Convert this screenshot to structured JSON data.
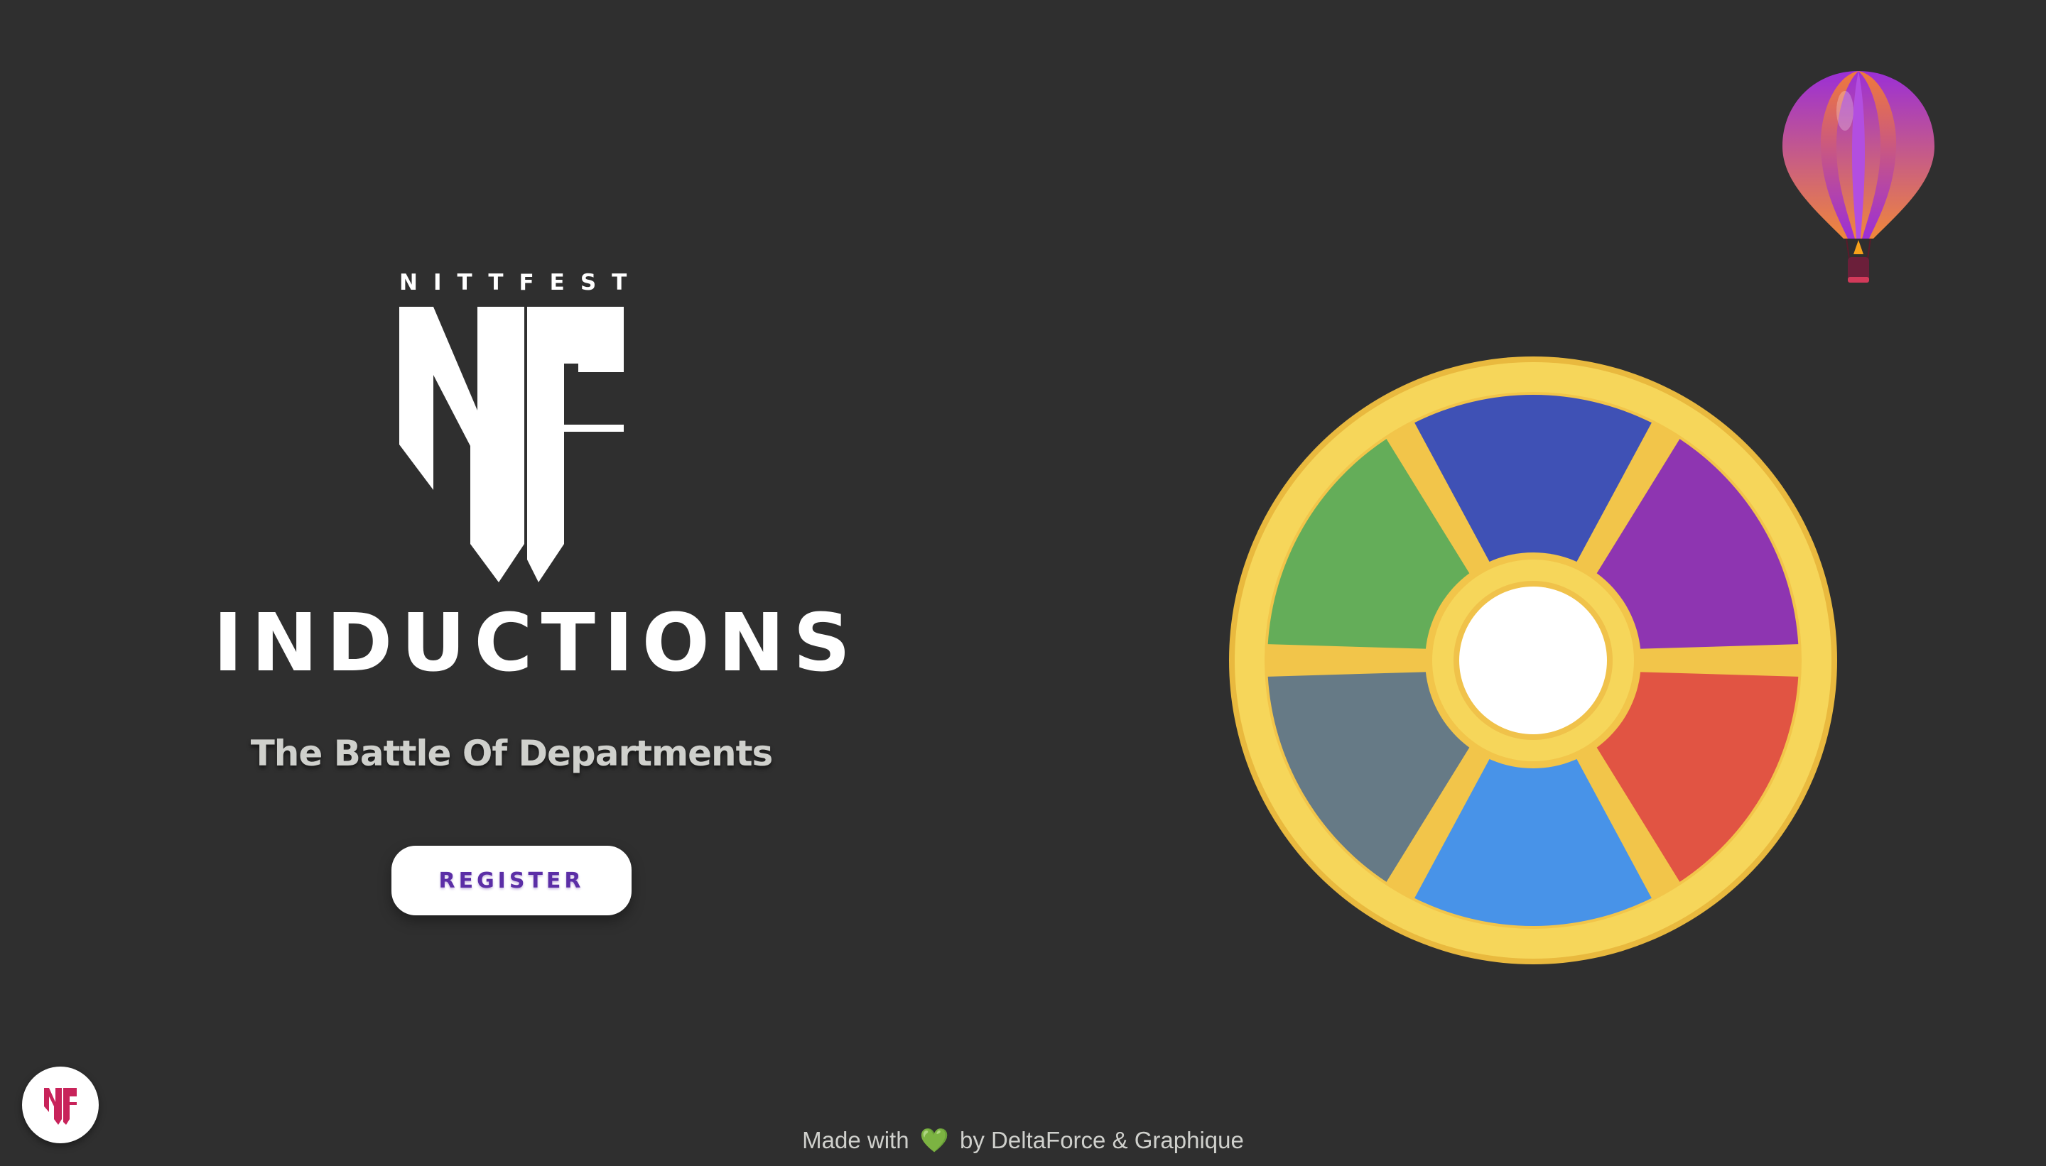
{
  "logo": {
    "wordmark": "NITTFEST",
    "monogram": "NF"
  },
  "hero": {
    "title": "INDUCTIONS",
    "subtitle": "The Battle Of Departments",
    "register_label": "REGISTER"
  },
  "wheel": {
    "segment_colors": [
      "#3f51b5",
      "#8e35b1",
      "#e15443",
      "#4893e8",
      "#667a86",
      "#64ad59"
    ],
    "rim_color": "#f6d65a",
    "hub_color": "#ffffff"
  },
  "footer": {
    "made_with": "Made with",
    "heart": "💚",
    "credits": "by DeltaForce & Graphique"
  },
  "colors": {
    "background": "#2f2f2f",
    "accent_purple": "#5b2ea6",
    "badge_logo": "#c8235a"
  }
}
